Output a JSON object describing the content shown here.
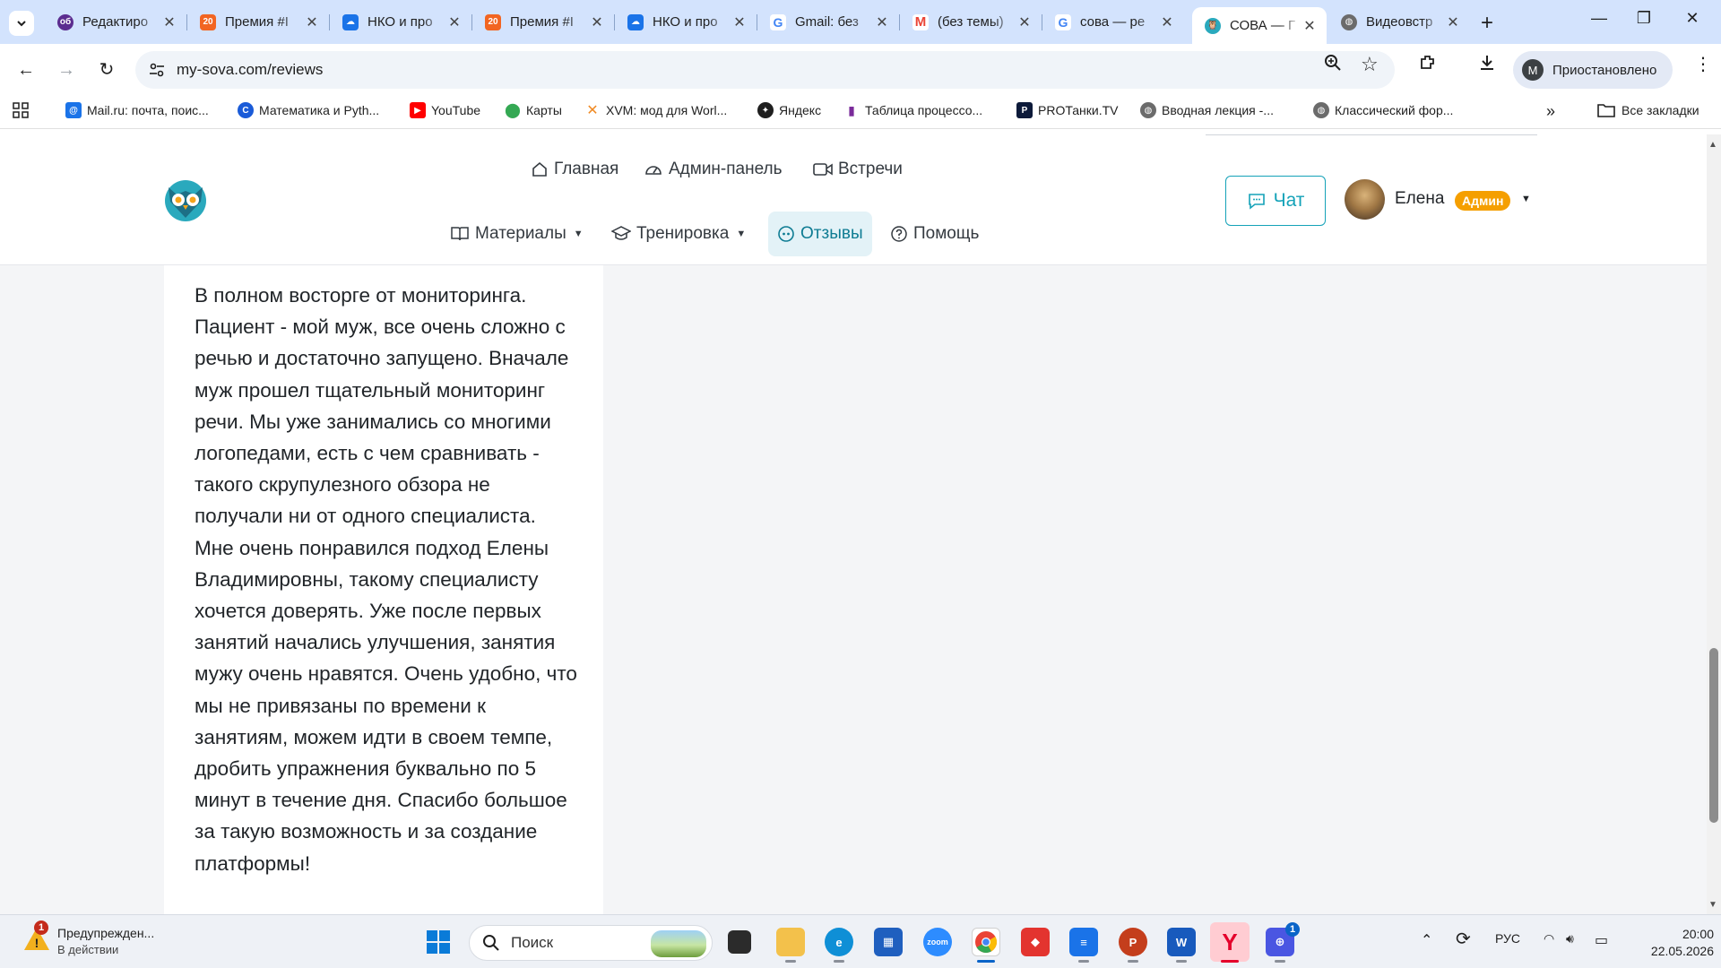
{
  "browser": {
    "tabs": [
      {
        "title": "Редактиро",
        "active": false
      },
      {
        "title": "Премия #I",
        "active": false
      },
      {
        "title": "НКО и про",
        "active": false
      },
      {
        "title": "Премия #I",
        "active": false
      },
      {
        "title": "НКО и про",
        "active": false
      },
      {
        "title": "Gmail: без",
        "active": false
      },
      {
        "title": "(без темы)",
        "active": false
      },
      {
        "title": "сова — ре",
        "active": false
      },
      {
        "title": "СОВА — Г",
        "active": true
      },
      {
        "title": "Видеовстр",
        "active": false
      }
    ],
    "url": "my-sova.com/reviews",
    "profile_status": "Приостановлено",
    "profile_initial": "M",
    "bookmarks": [
      {
        "label": "Mail.ru: почта, поис..."
      },
      {
        "label": "Математика и Pyth..."
      },
      {
        "label": "YouTube"
      },
      {
        "label": "Карты"
      },
      {
        "label": "XVM: мод для Worl..."
      },
      {
        "label": "Яндекс"
      },
      {
        "label": "Таблица процессо..."
      },
      {
        "label": "PROТанки.TV"
      },
      {
        "label": "Вводная лекция -..."
      },
      {
        "label": "Классический фор..."
      }
    ],
    "all_bookmarks": "Все закладки"
  },
  "site": {
    "nav_top": [
      {
        "label": "Главная"
      },
      {
        "label": "Админ-панель"
      },
      {
        "label": "Встречи"
      }
    ],
    "nav_bottom": [
      {
        "label": "Материалы"
      },
      {
        "label": "Тренировка"
      },
      {
        "label": "Отзывы"
      },
      {
        "label": "Помощь"
      }
    ],
    "chat_label": "Чат",
    "user_name": "Елена",
    "user_role": "Админ",
    "accent_color": "#14a2b8",
    "badge_color": "#f59f00"
  },
  "review": {
    "text": "В полном восторге от мониторинга. Пациент - мой муж, все очень сложно с речью и достаточно запущено. Вначале муж прошел тщательный мониторинг речи. Мы уже занимались со многими логопедами, есть с чем сравнивать - такого скрупулезного обзора не получали ни от одного специалиста. Мне очень понравился подход Елены Владимировны, такому специалисту хочется доверять. Уже после первых занятий начались улучшения, занятия мужу очень нравятся. Очень удобно, что мы не привязаны по времени к занятиям, можем идти в своем темпе, дробить упражнения буквально по 5 минут в течение дня. Спасибо большое за такую возможность и за создание платформы!"
  },
  "taskbar": {
    "notification_title": "Предупрежден...",
    "notification_sub": "В действии",
    "notification_count": "1",
    "search_label": "Поиск",
    "zoom_label": "zoom",
    "tasks_badge": "1",
    "language": "РУС",
    "time": "20:00",
    "date": "22.05.2026"
  }
}
